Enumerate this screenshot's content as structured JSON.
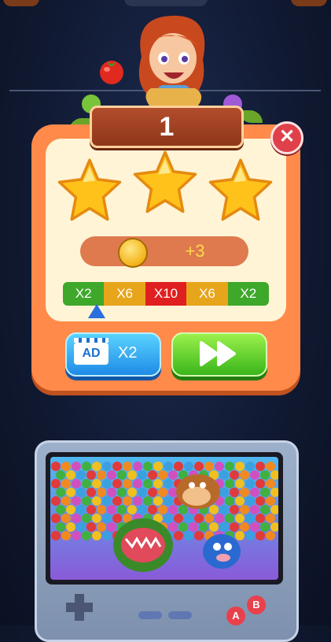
{
  "level": {
    "number": "1"
  },
  "close_icon": "close-icon",
  "stars": {
    "earned": 3,
    "total": 3
  },
  "reward": {
    "coin_icon": "coin-icon",
    "amount": "+3"
  },
  "multiplier": {
    "segments": [
      {
        "label": "X2",
        "color": "#3ea82a"
      },
      {
        "label": "X6",
        "color": "#e7a51c"
      },
      {
        "label": "X10",
        "color": "#e02020"
      },
      {
        "label": "X6",
        "color": "#e7a51c"
      },
      {
        "label": "X2",
        "color": "#3ea82a"
      }
    ],
    "pointer_segment": 0
  },
  "buttons": {
    "ad": {
      "icon_label": "AD",
      "label": "X2"
    },
    "next": {
      "icon": "fast-forward-icon"
    }
  },
  "console": {
    "a_label": "A",
    "b_label": "B"
  },
  "colors": {
    "panel": "#ff8a4a",
    "plaque": "#a8452a",
    "ad_button": "#2b9cf0",
    "next_button": "#55c823"
  }
}
